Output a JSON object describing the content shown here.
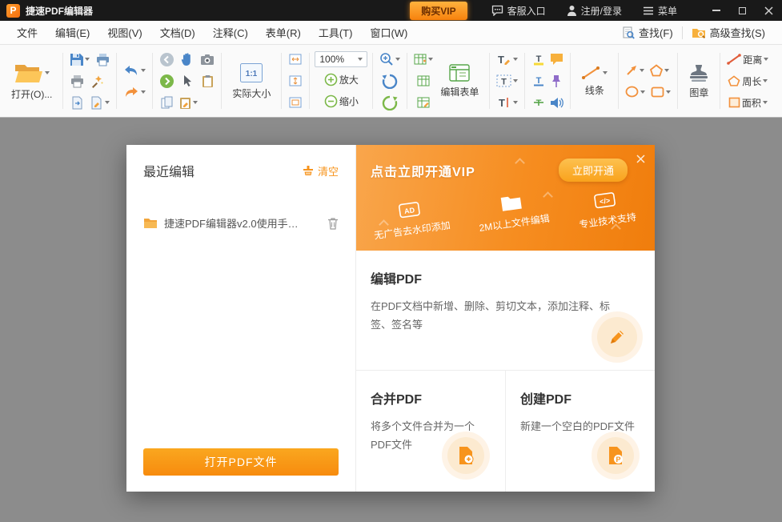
{
  "titlebar": {
    "logo_letter": "P",
    "app_title": "捷速PDF编辑器",
    "buy_vip_label": "购买VIP",
    "support_label": "客服入口",
    "login_label": "注册/登录",
    "menu_label": "菜单"
  },
  "menubar": {
    "items": [
      "文件",
      "编辑(E)",
      "视图(V)",
      "文档(D)",
      "注释(C)",
      "表单(R)",
      "工具(T)",
      "窗口(W)"
    ],
    "find_label": "查找(F)",
    "advanced_find_label": "高级查找(S)"
  },
  "toolbar": {
    "open_label": "打开(O)...",
    "actual_size_label": "实际大小",
    "zoom_value": "100%",
    "zoom_in_label": "放大",
    "zoom_out_label": "缩小",
    "edit_form_label": "编辑表单",
    "line_label": "线条",
    "stamp_label": "图章",
    "distance_label": "距离",
    "perimeter_label": "周长",
    "area_label": "面积"
  },
  "icons": {
    "one_to_one": "1:1",
    "ad": "AD",
    "code": "</>",
    "letter_t": "T",
    "letter_p": "P"
  },
  "dialog": {
    "recent": {
      "title": "最近编辑",
      "clear_label": "清空",
      "items": [
        {
          "name": "捷速PDF编辑器v2.0使用手…"
        }
      ],
      "open_button_label": "打开PDF文件"
    },
    "vip_banner": {
      "title": "点击立即开通VIP",
      "cta_label": "立即开通",
      "features": [
        {
          "icon": "ad-icon",
          "label": "无广告去水印添加"
        },
        {
          "icon": "folder-icon",
          "label": "2M以上文件编辑"
        },
        {
          "icon": "code-icon",
          "label": "专业技术支持"
        }
      ]
    },
    "sections": {
      "edit": {
        "title": "编辑PDF",
        "desc": "在PDF文档中新增、删除、剪切文本，添加注释、标签、签名等"
      },
      "merge": {
        "title": "合并PDF",
        "desc": "将多个文件合并为一个PDF文件"
      },
      "create": {
        "title": "创建PDF",
        "desc": "新建一个空白的PDF文件"
      }
    }
  },
  "colors": {
    "accent_orange": "#f7941d",
    "titlebar_bg": "#191919",
    "workspace_bg": "#8c8c8c"
  }
}
